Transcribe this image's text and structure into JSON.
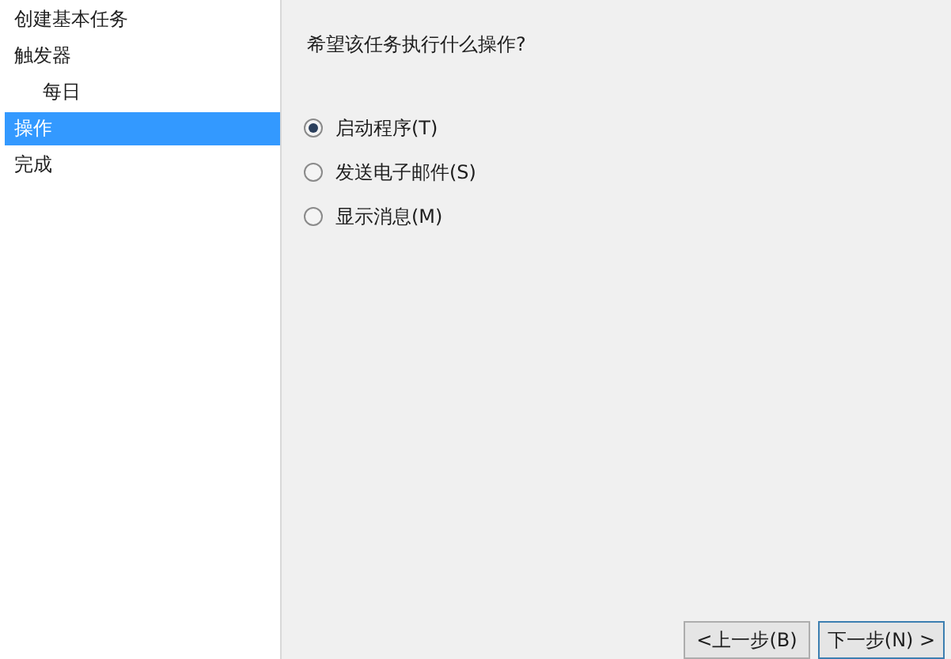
{
  "sidebar": {
    "items": [
      {
        "label": "创建基本任务",
        "selected": false
      },
      {
        "label": "触发器",
        "selected": false,
        "children": [
          {
            "label": "每日",
            "selected": false
          }
        ]
      },
      {
        "label": "操作",
        "selected": true
      },
      {
        "label": "完成",
        "selected": false
      }
    ]
  },
  "question": "希望该任务执行什么操作?",
  "options": [
    {
      "label": "启动程序(T)",
      "selected": true
    },
    {
      "label": "发送电子邮件(S)",
      "selected": false
    },
    {
      "label": "显示消息(M)",
      "selected": false
    }
  ],
  "buttons": [
    "<上一步(B)",
    "下一步(N) >"
  ]
}
